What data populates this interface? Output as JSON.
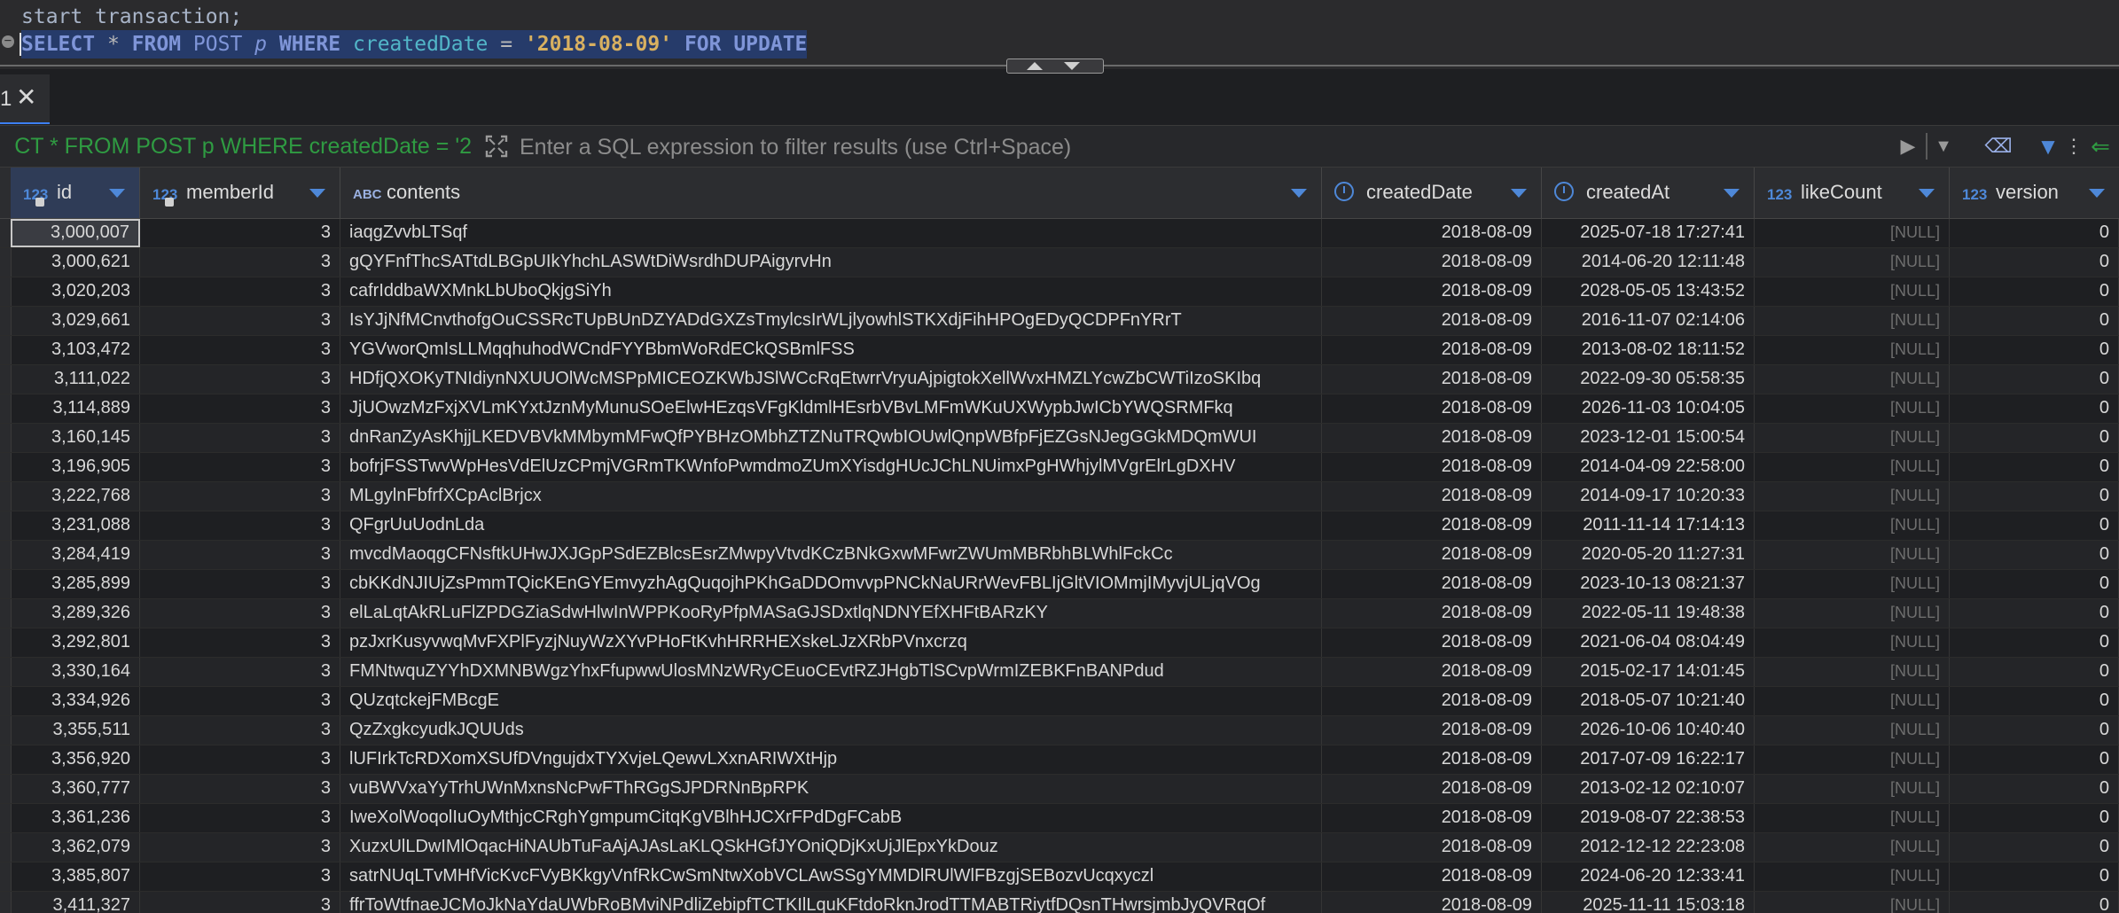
{
  "editor": {
    "line1": "start transaction;",
    "line2": {
      "select": "SELECT",
      "star": "*",
      "from": "FROM",
      "table": "POST",
      "alias": "p",
      "where": "WHERE",
      "column": "createdDate",
      "eq": "=",
      "value": "'2018-08-09'",
      "for_update": "FOR UPDATE"
    },
    "fold_marker": "−"
  },
  "results_tab": {
    "title": "1",
    "close": "✕"
  },
  "filter_bar": {
    "query_ref": "CT * FROM POST p WHERE createdDate = '2",
    "placeholder": "Enter a SQL expression to filter results (use Ctrl+Space)",
    "icons": [
      "expand-icon",
      "play-icon",
      "history-dropdown-icon",
      "eraser-icon",
      "filter-icon",
      "more-icon",
      "arrow-left-icon"
    ]
  },
  "grid": {
    "columns": [
      {
        "type": "123",
        "name": "id"
      },
      {
        "type": "123",
        "name": "memberId"
      },
      {
        "type": "ABC",
        "name": "contents"
      },
      {
        "type": "date",
        "name": "createdDate"
      },
      {
        "type": "datetime",
        "name": "createdAt"
      },
      {
        "type": "123",
        "name": "likeCount"
      },
      {
        "type": "123",
        "name": "version"
      }
    ],
    "rows": [
      [
        "3,000,007",
        "3",
        "iaqgZvvbLTSqf",
        "2018-08-09",
        "2025-07-18 17:27:41",
        "[NULL]",
        "0"
      ],
      [
        "3,000,621",
        "3",
        "gQYFnfThcSATtdLBGpUIkYhchLASWtDiWsrdhDUPAigyrvHn",
        "2018-08-09",
        "2014-06-20 12:11:48",
        "[NULL]",
        "0"
      ],
      [
        "3,020,203",
        "3",
        "cafrIddbaWXMnkLbUboQkjgSiYh",
        "2018-08-09",
        "2028-05-05 13:43:52",
        "[NULL]",
        "0"
      ],
      [
        "3,029,661",
        "3",
        "IsYJjNfMCnvthofgOuCSSRcTUpBUnDZYADdGXZsTmylcsIrWLjlyowhlSTKXdjFihHPOgEDyQCDPFnYRrT",
        "2018-08-09",
        "2016-11-07 02:14:06",
        "[NULL]",
        "0"
      ],
      [
        "3,103,472",
        "3",
        "YGVworQmIsLLMqqhuhodWCndFYYBbmWoRdECkQSBmlFSS",
        "2018-08-09",
        "2013-08-02 18:11:52",
        "[NULL]",
        "0"
      ],
      [
        "3,111,022",
        "3",
        "HDfjQXOKyTNIdiynNXUUOlWcMSPpMICEOZKWbJSlWCcRqEtwrrVryuAjpigtokXellWvxHMZLYcwZbCWTiIzoSKIbq",
        "2018-08-09",
        "2022-09-30 05:58:35",
        "[NULL]",
        "0"
      ],
      [
        "3,114,889",
        "3",
        "JjUOwzMzFxjXVLmKYxtJznMyMunuSOeElwHEzqsVFgKldmlHEsrbVBvLMFmWKuUXWypbJwICbYWQSRMFkq",
        "2018-08-09",
        "2026-11-03 10:04:05",
        "[NULL]",
        "0"
      ],
      [
        "3,160,145",
        "3",
        "dnRanZyAsKhjjLKEDVBVkMMbymMFwQfPYBHzOMbhZTZNuTRQwbIOUwlQnpWBfpFjEZGsNJegGGkMDQmWUI",
        "2018-08-09",
        "2023-12-01 15:00:54",
        "[NULL]",
        "0"
      ],
      [
        "3,196,905",
        "3",
        "bofrjFSSTwvWpHesVdElUzCPmjVGRmTKWnfoPwmdmoZUmXYisdgHUcJChLNUimxPgHWhjylMVgrElrLgDXHV",
        "2018-08-09",
        "2014-04-09 22:58:00",
        "[NULL]",
        "0"
      ],
      [
        "3,222,768",
        "3",
        "MLgylnFbfrfXCpAclBrjcx",
        "2018-08-09",
        "2014-09-17 10:20:33",
        "[NULL]",
        "0"
      ],
      [
        "3,231,088",
        "3",
        "QFgrUuUodnLda",
        "2018-08-09",
        "2011-11-14 17:14:13",
        "[NULL]",
        "0"
      ],
      [
        "3,284,419",
        "3",
        "mvcdMaoqgCFNsftkUHwJXJGpPSdEZBlcsEsrZMwpyVtvdKCzBNkGxwMFwrZWUmMBRbhBLWhlFckCc",
        "2018-08-09",
        "2020-05-20 11:27:31",
        "[NULL]",
        "0"
      ],
      [
        "3,285,899",
        "3",
        "cbKKdNJIUjZsPmmTQicKEnGYEmvyzhAgQuqojhPKhGaDDOmvvpPNCkNaURrWevFBLIjGltVIOMmjIMyvjULjqVOg",
        "2018-08-09",
        "2023-10-13 08:21:37",
        "[NULL]",
        "0"
      ],
      [
        "3,289,326",
        "3",
        "elLaLqtAkRLuFlZPDGZiaSdwHlwInWPPKooRyPfpMASaGJSDxtlqNDNYEfXHFtBARzKY",
        "2018-08-09",
        "2022-05-11 19:48:38",
        "[NULL]",
        "0"
      ],
      [
        "3,292,801",
        "3",
        "pzJxrKusyvwqMvFXPlFyzjNuyWzXYvPHoFtKvhHRRHEXskeLJzXRbPVnxcrzq",
        "2018-08-09",
        "2021-06-04 08:04:49",
        "[NULL]",
        "0"
      ],
      [
        "3,330,164",
        "3",
        "FMNtwquZYYhDXMNBWgzYhxFfupwwUlosMNzWRyCEuoCEvtRZJHgbTlSCvpWrmIZEBKFnBANPdud",
        "2018-08-09",
        "2015-02-17 14:01:45",
        "[NULL]",
        "0"
      ],
      [
        "3,334,926",
        "3",
        "QUzqtckejFMBcgE",
        "2018-08-09",
        "2018-05-07 10:21:40",
        "[NULL]",
        "0"
      ],
      [
        "3,355,511",
        "3",
        "QzZxgkcyudkJQUUds",
        "2018-08-09",
        "2026-10-06 10:40:40",
        "[NULL]",
        "0"
      ],
      [
        "3,356,920",
        "3",
        "lUFIrkTcRDXomXSUfDVngujdxTYXvjeLQewvLXxnARIWXtHjp",
        "2018-08-09",
        "2017-07-09 16:22:17",
        "[NULL]",
        "0"
      ],
      [
        "3,360,777",
        "3",
        "vuBWVxaYyTrhUWnMxnsNcPwFThRGgSJPDRNnBpRPK",
        "2018-08-09",
        "2013-02-12 02:10:07",
        "[NULL]",
        "0"
      ],
      [
        "3,361,236",
        "3",
        "IweXolWoqolIuOyMthjcCRghYgmpumCitqKgVBlhHJCXrFPdDgFCabB",
        "2018-08-09",
        "2019-08-07 22:38:53",
        "[NULL]",
        "0"
      ],
      [
        "3,362,079",
        "3",
        "XuzxUlLDwIMlOqacHiNAUbTuFaAjAJAsLaKLQSkHGfJYOniQDjKxUjJlEpxYkDouz",
        "2018-08-09",
        "2012-12-12 22:23:08",
        "[NULL]",
        "0"
      ],
      [
        "3,385,807",
        "3",
        "satrNUqLTvMHfVicKvcFVyBKkgyVnfRkCwSmNtwXobVCLAwSSgYMMDlRUlWlFBzgjSEBozvUcqxyczl",
        "2018-08-09",
        "2024-06-20 12:33:41",
        "[NULL]",
        "0"
      ],
      [
        "3,411,327",
        "3",
        "ffrToWtfnaeJCMoJkNaYdaUWbRoBMviNPdliZebipfTCTKIlLquKFtdoRknJrodTTMABTRiytfDQsnTHwrsjmbJyQVRqOf",
        "2018-08-09",
        "2025-11-11 15:03:18",
        "[NULL]",
        "0"
      ]
    ]
  },
  "colors": {
    "background": "#1e1f22",
    "selection": "#263b6a",
    "keyword": "#7f95d8",
    "column": "#52b6c8",
    "string": "#d8b060",
    "query_ref": "#2f9b42",
    "header_type": "#4e88d8",
    "null": "#6e6e6e"
  }
}
